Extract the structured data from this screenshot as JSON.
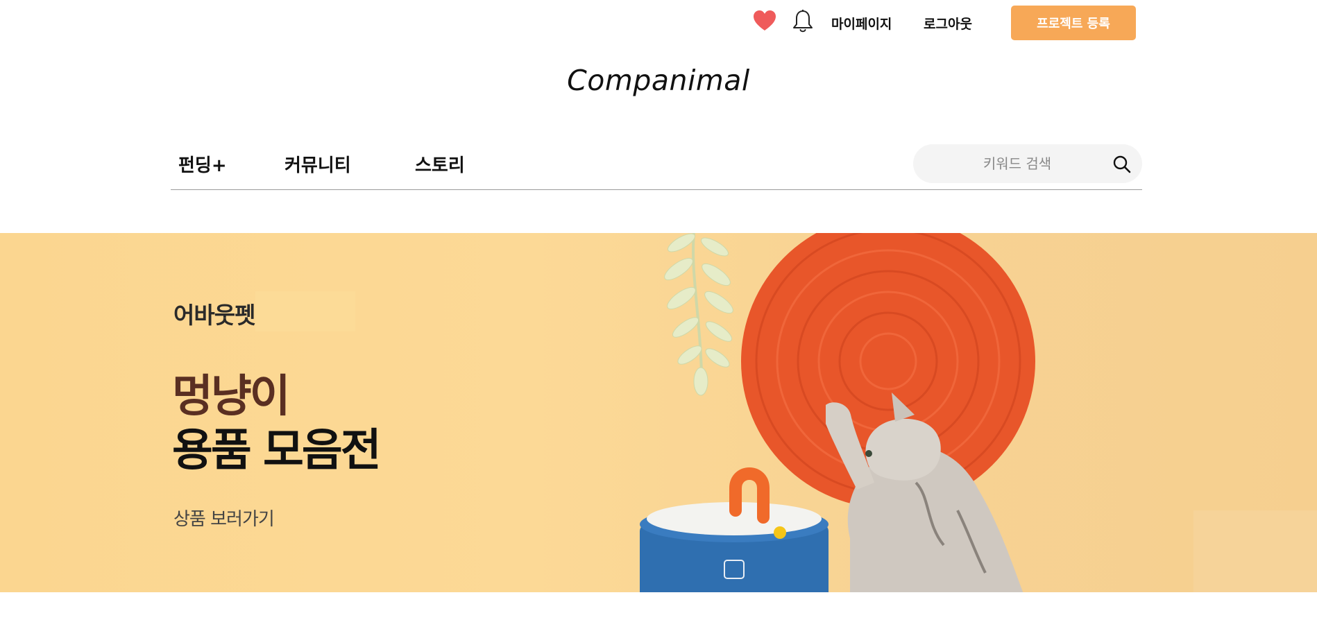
{
  "header": {
    "mypage_label": "마이페이지",
    "logout_label": "로그아웃",
    "register_label": "프로젝트 등록",
    "heart_icon": "heart-icon",
    "bell_icon": "bell-icon"
  },
  "logo": {
    "text": "Companimal"
  },
  "nav": {
    "items": [
      {
        "label": "펀딩+"
      },
      {
        "label": "커뮤니티"
      },
      {
        "label": "스토리"
      }
    ]
  },
  "search": {
    "placeholder": "키워드 검색",
    "value": "",
    "icon": "search-icon"
  },
  "banner": {
    "brand": "어바웃펫",
    "headline_line1": "멍냥이",
    "headline_line2": "용품 모음전",
    "link_text": "상품 보러가기"
  },
  "colors": {
    "accent": "#f7a857",
    "banner_bg": "#fcd996",
    "headline_brown": "#5a2f22",
    "heart": "#ef5b5b",
    "scratcher_red": "#e8562a",
    "fountain_blue": "#2f6fb0"
  }
}
